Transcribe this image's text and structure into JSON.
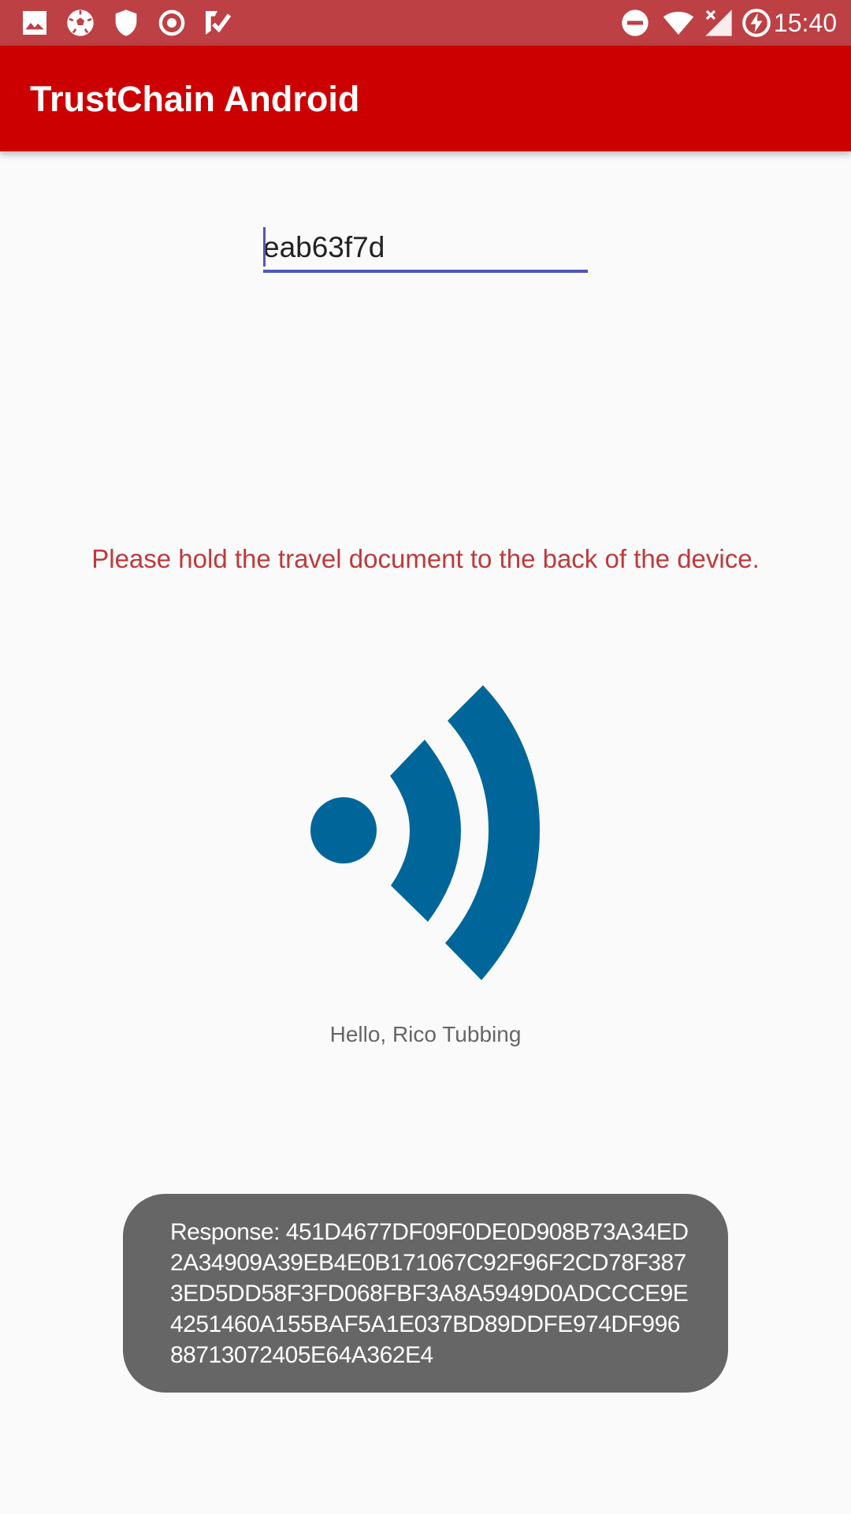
{
  "status_bar": {
    "time": "15:40",
    "left_icons": [
      "gallery-icon",
      "soccer-ball-icon",
      "shield-icon",
      "record-icon",
      "task-check-icon"
    ],
    "right_icons": [
      "do-not-disturb-icon",
      "wifi-icon",
      "signal-no-service-icon",
      "battery-charging-icon"
    ],
    "background": "#BD4044"
  },
  "app_bar": {
    "title": "TrustChain Android",
    "background": "#CC0000"
  },
  "input": {
    "value": "eab63f7d",
    "accent": "#5057B8"
  },
  "instruction": {
    "text": "Please hold the travel document to the back of the device.",
    "color": "#C0393B"
  },
  "nfc_logo": {
    "icon": "nfc-icon",
    "color": "#006699"
  },
  "greeting": {
    "text": "Hello, Rico Tubbing"
  },
  "toast": {
    "text": "Response: 451D4677DF09F0DE0D908B73A34ED2A34909A39EB4E0B171067C92F96F2CD78F3873ED5DD58F3FD068FBF3A8A5949D0ADCCCE9E4251460A155BAF5A1E037BD89DDFE974DF99688713072405E64A362E4",
    "background": "#666666"
  }
}
